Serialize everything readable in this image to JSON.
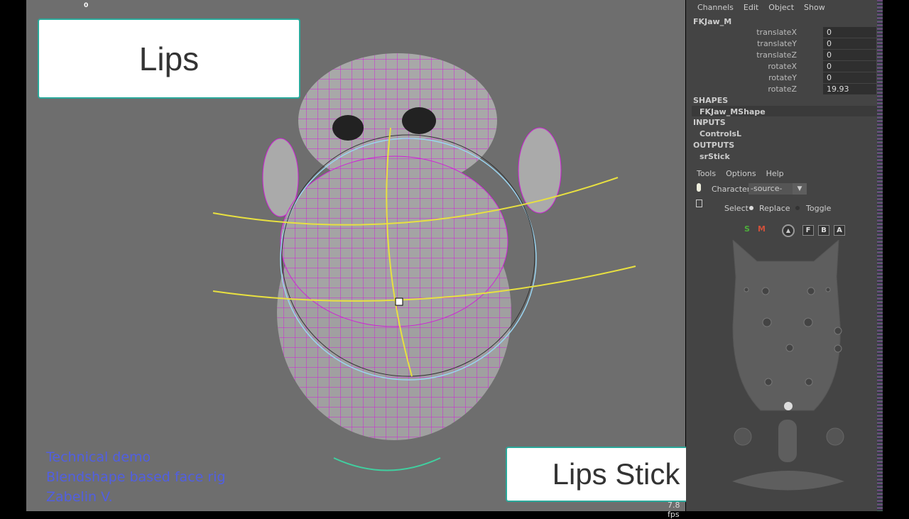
{
  "viewport": {
    "frame": "0",
    "fps": "7.8 fps",
    "label_top": "Lips",
    "label_bottom": "Lips Stick",
    "credits": [
      "Technical demo",
      "Blendshape based face rig",
      "Zabelin V."
    ]
  },
  "channelbox": {
    "menu": [
      "Channels",
      "Edit",
      "Object",
      "Show"
    ],
    "object": "FKJaw_M",
    "attributes": [
      {
        "name": "translateX",
        "value": "0"
      },
      {
        "name": "translateY",
        "value": "0"
      },
      {
        "name": "translateZ",
        "value": "0"
      },
      {
        "name": "rotateX",
        "value": "0"
      },
      {
        "name": "rotateY",
        "value": "0"
      },
      {
        "name": "rotateZ",
        "value": "19.93"
      }
    ],
    "shapes_label": "SHAPES",
    "shape": "FKJaw_MShape",
    "inputs_label": "INPUTS",
    "input": "ControlsL",
    "outputs_label": "OUTPUTS",
    "output": "srStick"
  },
  "picker": {
    "menu": [
      "Tools",
      "Options",
      "Help"
    ],
    "character_label": "Character",
    "character_value": "-source-",
    "select_label": "Select",
    "replace_label": "Replace",
    "toggle_label": "Toggle",
    "s": "S",
    "m": "M",
    "f": "F",
    "b": "B",
    "a": "A",
    "colors": {
      "s": "#4caf3a",
      "m": "#d0503a"
    }
  }
}
